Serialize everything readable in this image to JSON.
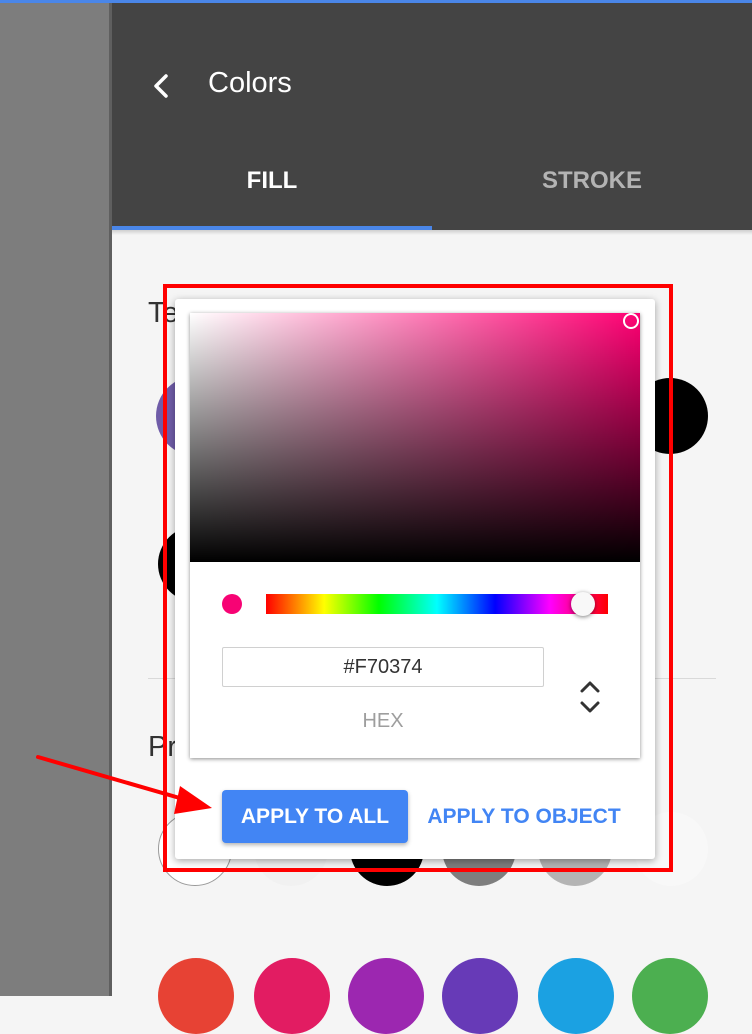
{
  "header": {
    "title": "Colors",
    "tabs": [
      {
        "label": "FILL",
        "active": true
      },
      {
        "label": "STROKE",
        "active": false
      }
    ]
  },
  "sections": {
    "section_1_label": "Te",
    "section_2_label": "Pr"
  },
  "color_picker": {
    "hex_value": "#F70374",
    "mode_label": "HEX",
    "hue_color": "#ff0073",
    "selected_color": "#F70374"
  },
  "actions": {
    "apply_all": "APPLY TO ALL",
    "apply_object": "APPLY TO OBJECT"
  },
  "swatches": {
    "bottom_row": [
      "#e74234",
      "#e21c62",
      "#9c27b0",
      "#673ab7",
      "#1ba1e2",
      "#4caf50"
    ]
  },
  "colors": {
    "header_bg": "#444444",
    "accent": "#4285f4",
    "annotation": "#ff0000"
  }
}
